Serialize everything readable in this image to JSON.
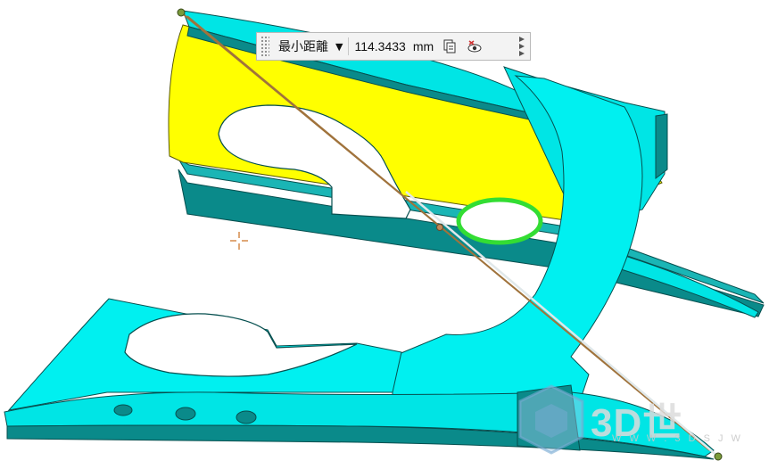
{
  "measurement": {
    "label": "最小距離",
    "dropdown_arrow": "▼",
    "value": "114.3433",
    "unit": "mm",
    "icons": [
      "copy-measurement-icon",
      "visibility-icon"
    ]
  },
  "watermark": {
    "text": "3D世",
    "subtext": "W W W . 3 D S J W"
  },
  "colors": {
    "part_face": "#00f0f0",
    "part_side": "#0a8a8a",
    "selected_face": "#ffff00",
    "highlight_edge": "#33dd33",
    "measure_line": "#a0733c"
  }
}
